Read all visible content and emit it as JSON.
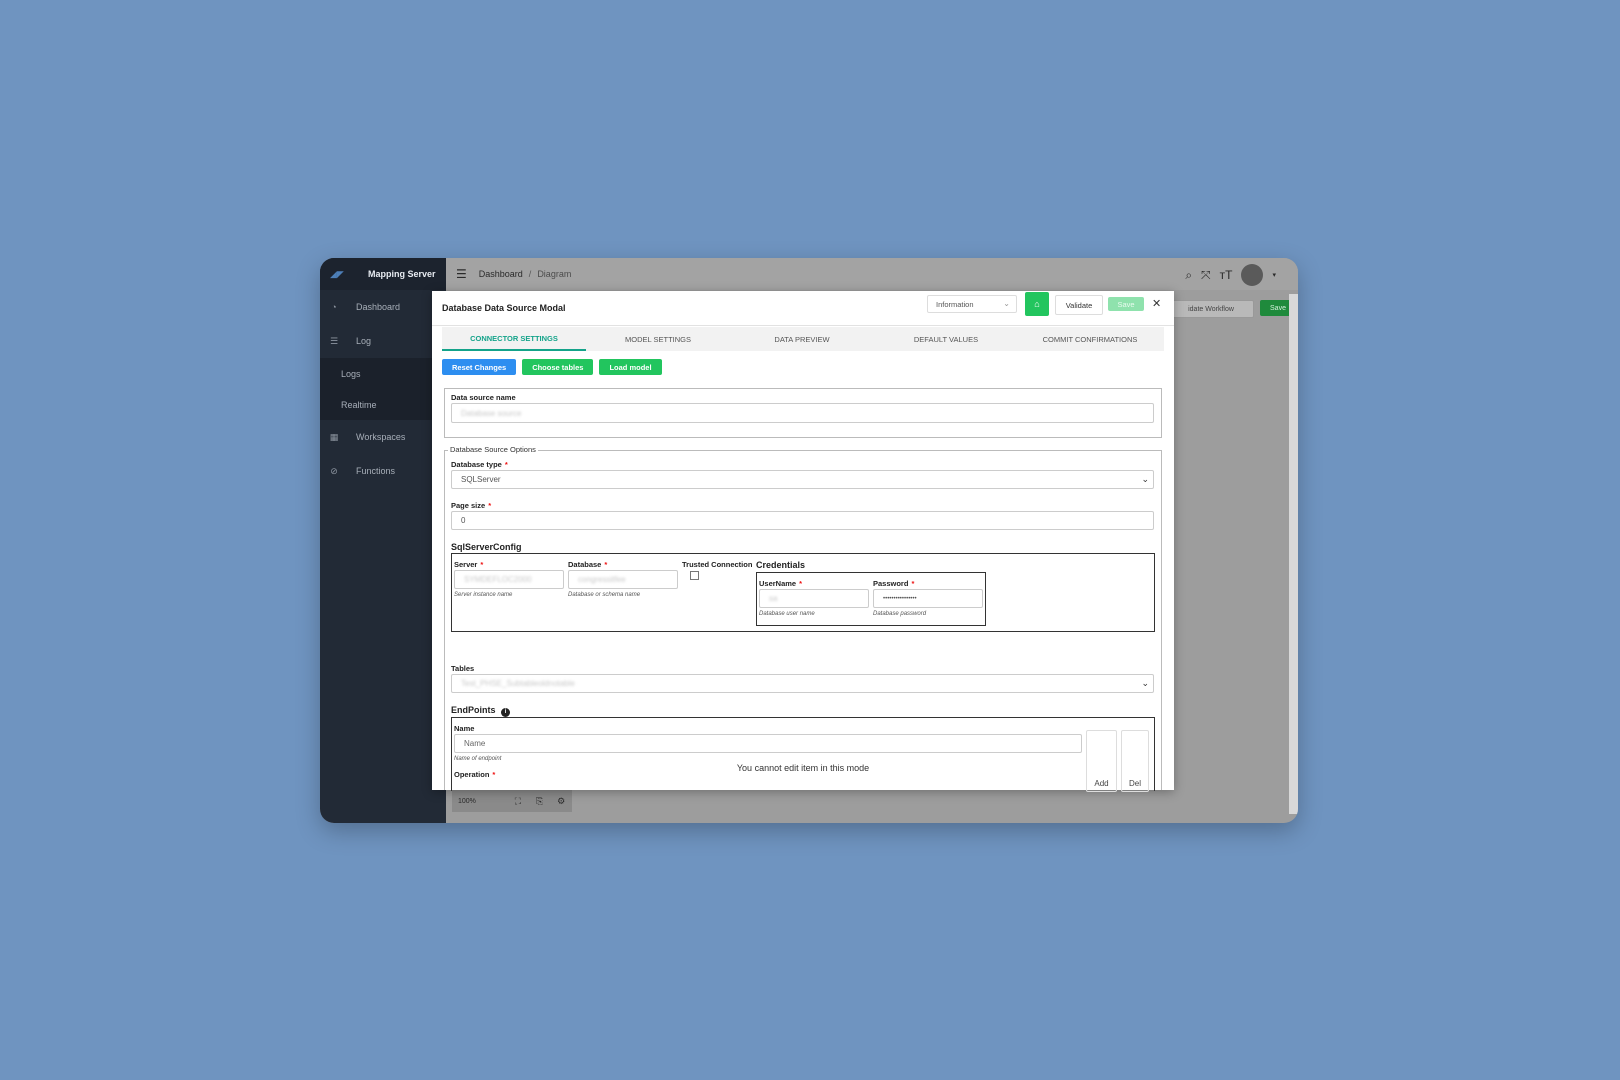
{
  "app": {
    "brand": "Mapping Server",
    "sidebar": {
      "items": [
        {
          "label": "Dashboard",
          "icon": "dashboard-icon"
        },
        {
          "label": "Log",
          "icon": "list-icon",
          "children": [
            "Logs",
            "Realtime"
          ]
        },
        {
          "label": "Workspaces",
          "icon": "grid-icon"
        },
        {
          "label": "Functions",
          "icon": "function-icon"
        }
      ]
    },
    "breadcrumb": [
      "Dashboard",
      "/",
      "Diagram"
    ],
    "topbar_icons": [
      "search-icon",
      "fullscreen-icon",
      "text-size-icon",
      "avatar-icon"
    ],
    "background_buttons": {
      "validate_workflow": "idate Workflow",
      "save": "Save"
    },
    "zoom": "100%"
  },
  "modal": {
    "title": "Database Data Source Modal",
    "log_level": "Information",
    "validate_label": "Validate",
    "save_label": "Save",
    "tabs": [
      "CONNECTOR SETTINGS",
      "MODEL SETTINGS",
      "DATA PREVIEW",
      "DEFAULT VALUES",
      "COMMIT CONFIRMATIONS"
    ],
    "active_tab": "CONNECTOR SETTINGS",
    "actions": [
      "Reset Changes",
      "Choose tables",
      "Load model"
    ],
    "form": {
      "datasource_name_label": "Data source name",
      "datasource_name_value": "Database source",
      "options_legend": "Database Source Options",
      "database_type_label": "Database type",
      "database_type_value": "SQLServer",
      "page_size_label": "Page size",
      "page_size_value": "0",
      "config_title": "SqlServerConfig",
      "server_label": "Server",
      "server_value": "SYMDEFLOC2000",
      "server_hint": "Server instance name",
      "database_label": "Database",
      "database_value": "congressitfee",
      "database_hint": "Database or schema name",
      "trusted_label": "Trusted Connection",
      "credentials_title": "Credentials",
      "username_label": "UserName",
      "username_value": "sa",
      "username_hint": "Database user name",
      "password_label": "Password",
      "password_value": "••••••••••••••••",
      "password_hint": "Database password",
      "tables_label": "Tables",
      "tables_value": "Test_PHSE_Subtableoldnotable",
      "endpoints_title": "EndPoints",
      "endpoint_name_label": "Name",
      "endpoint_name_placeholder": "Name",
      "endpoint_name_hint": "Name of endpoint",
      "operation_label": "Operation",
      "add_label": "Add",
      "del_label": "Del"
    },
    "notice": "You cannot edit item in this mode"
  },
  "colors": {
    "backdrop": "#6f94c0",
    "sidebar": "#222a36",
    "accent_teal": "#14a38a",
    "primary_blue": "#2d8ef0",
    "success_green": "#22c55e"
  }
}
